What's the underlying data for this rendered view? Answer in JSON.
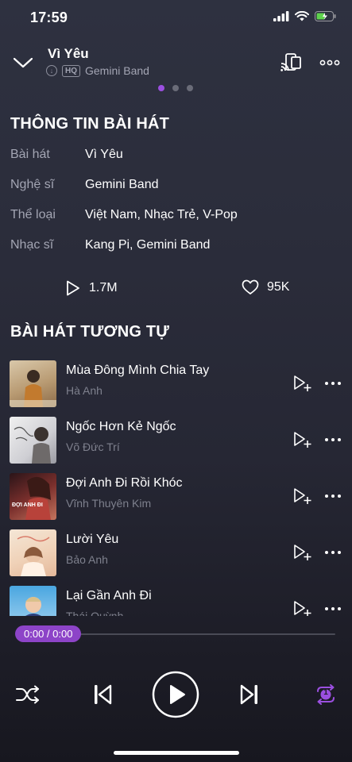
{
  "status_bar": {
    "time": "17:59"
  },
  "now_playing": {
    "title": "Vì Yêu",
    "quality_badge": "HQ",
    "artist": "Gemini Band",
    "page_count": 3,
    "active_page": 1
  },
  "song_info": {
    "heading": "THÔNG TIN BÀI HÁT",
    "rows": [
      {
        "label": "Bài hát",
        "value": "Vì Yêu"
      },
      {
        "label": "Nghệ sĩ",
        "value": "Gemini Band"
      },
      {
        "label": "Thể loại",
        "value": "Việt Nam, Nhạc Trẻ, V-Pop"
      },
      {
        "label": "Nhạc sĩ",
        "value": "Kang Pi, Gemini Band"
      }
    ],
    "plays": "1.7M",
    "likes": "95K"
  },
  "similar": {
    "heading": "BÀI HÁT TƯƠNG TỰ",
    "songs": [
      {
        "title": "Mùa Đông Mình Chia Tay",
        "artist": "Hà Anh"
      },
      {
        "title": "Ngốc Hơn Kẻ Ngốc",
        "artist": "Võ Đức Trí"
      },
      {
        "title": "Đợi Anh Đi Rồi Khóc",
        "artist": "Vĩnh Thuyên Kim",
        "thumb_text": "ĐỢI ANH ĐI"
      },
      {
        "title": "Lười Yêu",
        "artist": "Bảo Anh"
      },
      {
        "title": "Lại Gần Anh Đi",
        "artist": "Thái Quỳnh"
      }
    ]
  },
  "player": {
    "time_display": "0:00 / 0:00",
    "progress": 0,
    "repeat_count": "1"
  },
  "colors": {
    "accent": "#9b4fe0",
    "progress_pill": "#8d44c8",
    "muted_text": "#a3a5b3",
    "artist_text": "#7e808d"
  },
  "icons": [
    "chevron-down-icon",
    "download-icon",
    "cast-icon",
    "more-icon",
    "play-outline-icon",
    "heart-icon",
    "add-to-queue-icon",
    "shuffle-icon",
    "previous-icon",
    "play-icon",
    "next-icon",
    "repeat-one-icon"
  ]
}
